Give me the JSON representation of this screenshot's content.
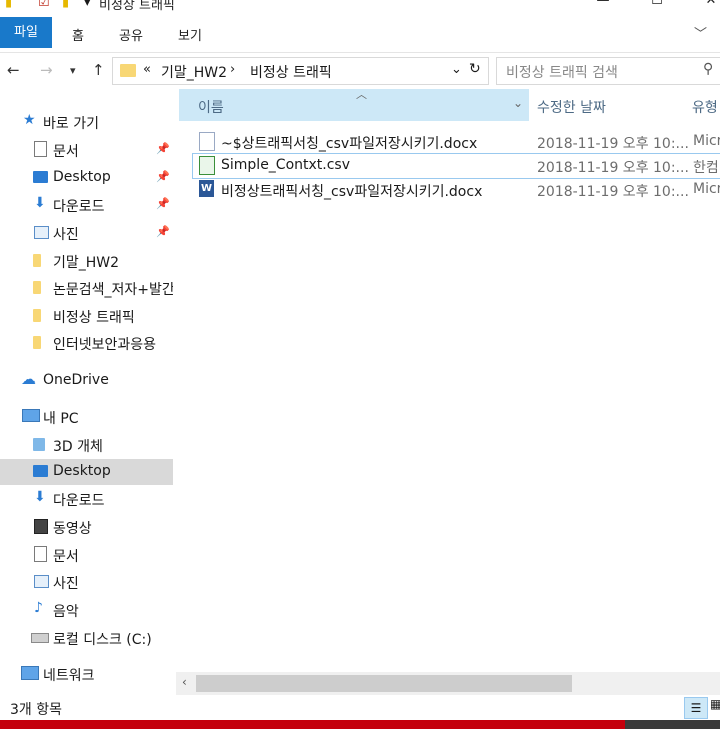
{
  "window": {
    "title": "비정상 트래픽"
  },
  "ribbon": {
    "tabs": [
      "파일",
      "홈",
      "공유",
      "보기"
    ]
  },
  "address": {
    "prefix": "«",
    "crumbs": [
      "기말_HW2",
      "비정상 트래픽"
    ],
    "search_placeholder": "비정상 트래픽 검색"
  },
  "nav": {
    "quick_access": "바로 가기",
    "quick_items": [
      "문서",
      "Desktop",
      "다운로드",
      "사진",
      "기말_HW2",
      "논문검색_저자+발간",
      "비정상 트래픽",
      "인터넷보안과응용"
    ],
    "onedrive": "OneDrive",
    "this_pc": "내 PC",
    "pc_items": [
      "3D 개체",
      "Desktop",
      "다운로드",
      "동영상",
      "문서",
      "사진",
      "음악",
      "로컬 디스크 (C:)"
    ],
    "network": "네트워크"
  },
  "columns": {
    "name": "이름",
    "date": "수정한 날짜",
    "type": "유형"
  },
  "files": [
    {
      "name": "~$상트래픽서칭_csv파일저장시키기.docx",
      "date": "2018-11-19 오후 10:...",
      "type": "Micr",
      "icon": "word-temp-icon"
    },
    {
      "name": "Simple_Contxt.csv",
      "date": "2018-11-19 오후 10:...",
      "type": "한컴",
      "icon": "csv-icon"
    },
    {
      "name": "비정상트래픽서칭_csv파일저장시키기.docx",
      "date": "2018-11-19 오후 10:...",
      "type": "Micr",
      "icon": "word-icon"
    }
  ],
  "status": {
    "count": "3개 항목"
  },
  "colors": {
    "accent": "#1979ca",
    "header_selected": "#cde8f7",
    "folder": "#f8d775"
  }
}
